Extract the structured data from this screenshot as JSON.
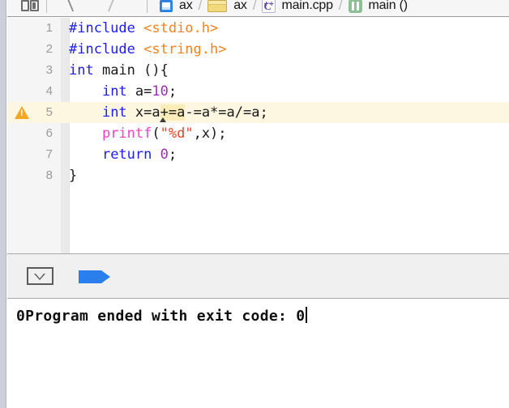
{
  "jumpbar": {
    "panels_icon": "panels-icon",
    "back_icon": "chevron-back-icon",
    "forward_icon": "chevron-forward-icon",
    "crumbs": [
      {
        "icon": "project-icon",
        "label": "ax"
      },
      {
        "icon": "folder-icon",
        "label": "ax"
      },
      {
        "icon": "cpp-file-icon",
        "label": "main.cpp"
      },
      {
        "icon": "method-icon",
        "label": "main ()"
      }
    ],
    "separator": "/"
  },
  "editor": {
    "lines": [
      {
        "num": "1",
        "warn": false,
        "tokens": [
          {
            "t": "#include ",
            "c": "tk-pre"
          },
          {
            "t": "<stdio.h>",
            "c": "tk-hdr"
          }
        ]
      },
      {
        "num": "2",
        "warn": false,
        "tokens": [
          {
            "t": "#include ",
            "c": "tk-pre"
          },
          {
            "t": "<string.h>",
            "c": "tk-hdr"
          }
        ]
      },
      {
        "num": "3",
        "warn": false,
        "tokens": [
          {
            "t": "int",
            "c": "tk-kw"
          },
          {
            "t": " main (){",
            "c": "tk-plain"
          }
        ]
      },
      {
        "num": "4",
        "warn": false,
        "tokens": [
          {
            "t": "    ",
            "c": "tk-plain"
          },
          {
            "t": "int",
            "c": "tk-kw"
          },
          {
            "t": " a=",
            "c": "tk-plain"
          },
          {
            "t": "10",
            "c": "tk-num"
          },
          {
            "t": ";",
            "c": "tk-plain"
          }
        ]
      },
      {
        "num": "5",
        "warn": true,
        "tokens": [
          {
            "t": "    ",
            "c": "tk-plain"
          },
          {
            "t": "int",
            "c": "tk-kw"
          },
          {
            "t": " x=a",
            "c": "tk-plain"
          },
          {
            "t": "+=a",
            "c": "tk-plain hl-tok"
          },
          {
            "t": "-=a*=a/=a;",
            "c": "tk-plain"
          }
        ]
      },
      {
        "num": "6",
        "warn": false,
        "caret_after": 11,
        "tokens": [
          {
            "t": "    ",
            "c": "tk-plain"
          },
          {
            "t": "printf",
            "c": "tk-fn"
          },
          {
            "t": "(",
            "c": "tk-plain"
          },
          {
            "t": "\"%d\"",
            "c": "tk-str"
          },
          {
            "t": ",x);",
            "c": "tk-plain"
          }
        ]
      },
      {
        "num": "7",
        "warn": false,
        "tokens": [
          {
            "t": "    ",
            "c": "tk-plain"
          },
          {
            "t": "return",
            "c": "tk-kw"
          },
          {
            "t": " ",
            "c": "tk-plain"
          },
          {
            "t": "0",
            "c": "tk-num"
          },
          {
            "t": ";",
            "c": "tk-plain"
          }
        ]
      },
      {
        "num": "8",
        "warn": false,
        "tokens": [
          {
            "t": "}",
            "c": "tk-plain"
          }
        ]
      }
    ],
    "warning_icon": "warning-triangle-icon"
  },
  "debugbar": {
    "toggle_icon": "hide-debug-area-icon",
    "flag_icon": "step-arrow-icon"
  },
  "console": {
    "output": "0Program ended with exit code: 0"
  },
  "colors": {
    "preprocessor": "#1d1df0",
    "header": "#f58220",
    "keyword": "#1d1df0",
    "number": "#9b32b5",
    "function": "#ef40c8",
    "string": "#e8452c",
    "warning": "#f5a623",
    "highlight_line": "#fdf6e0",
    "accent_blue": "#2a7fec"
  }
}
